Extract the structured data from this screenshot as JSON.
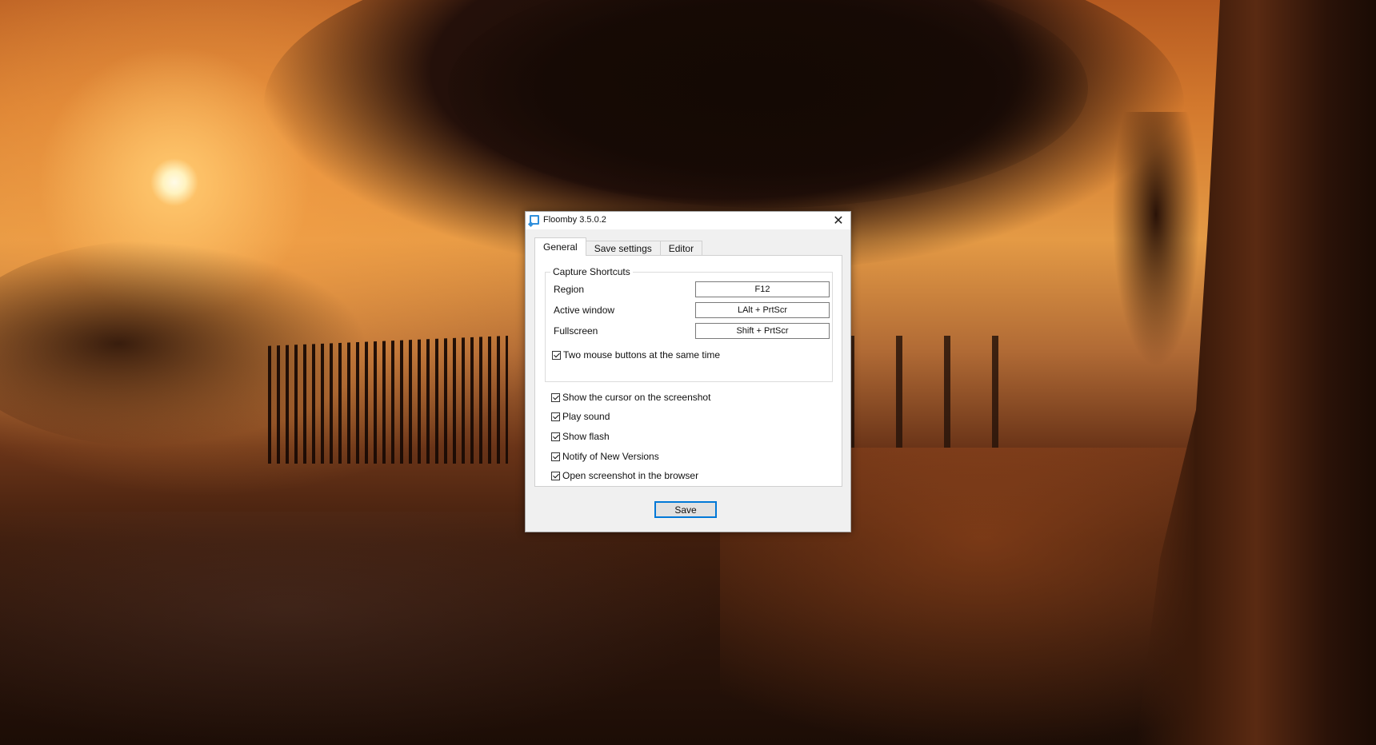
{
  "window": {
    "title": "Floomby 3.5.0.2",
    "close_glyph": "✕",
    "app_icon": "floomby-logo-icon"
  },
  "tabs": [
    {
      "label": "General",
      "active": true
    },
    {
      "label": "Save settings",
      "active": false
    },
    {
      "label": "Editor",
      "active": false
    }
  ],
  "capture_shortcuts": {
    "legend": "Capture Shortcuts",
    "rows": [
      {
        "label": "Region",
        "hotkey": "F12"
      },
      {
        "label": "Active window",
        "hotkey": "LAlt + PrtScr"
      },
      {
        "label": "Fullscreen",
        "hotkey": "Shift + PrtScr"
      }
    ],
    "two_mouse_buttons": {
      "label": "Two mouse buttons at the same time",
      "checked": true
    }
  },
  "options": [
    {
      "label": "Show the cursor on the screenshot",
      "checked": true
    },
    {
      "label": "Play sound",
      "checked": true
    },
    {
      "label": "Show flash",
      "checked": true
    },
    {
      "label": "Notify of New Versions",
      "checked": true
    },
    {
      "label": "Open screenshot in the browser",
      "checked": true
    }
  ],
  "footer": {
    "save_label": "Save"
  },
  "colors": {
    "accent": "#0078d7",
    "icon": "#2f8fdc"
  }
}
